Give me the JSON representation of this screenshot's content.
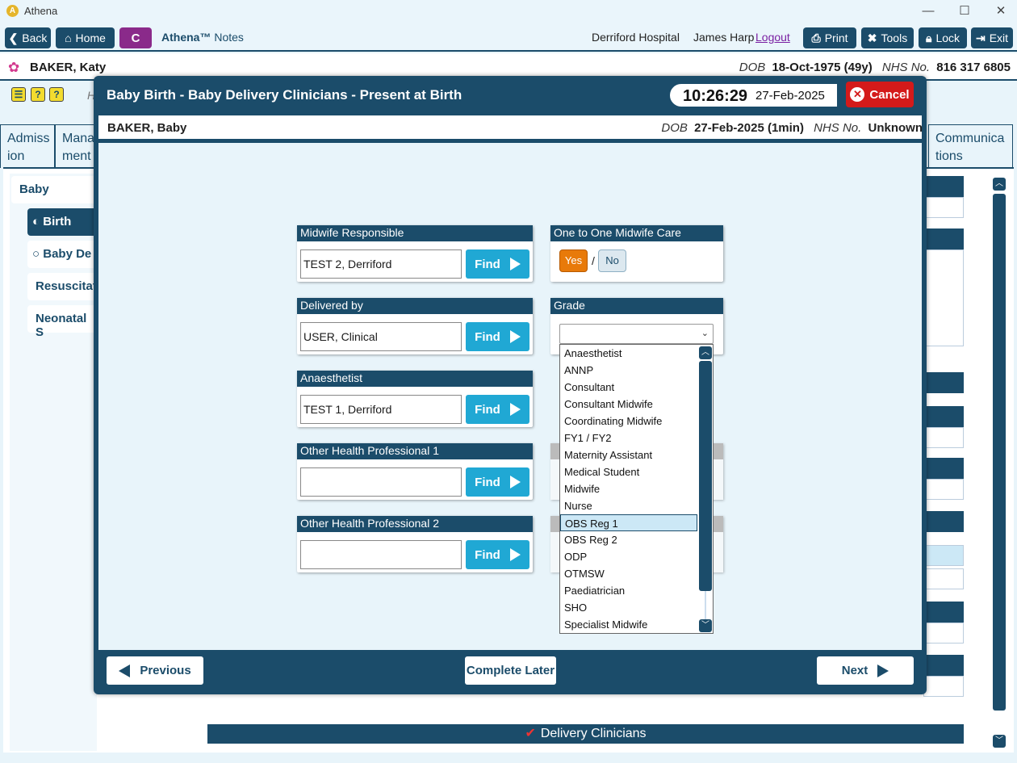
{
  "window": {
    "title": "Athena",
    "minimize": "—",
    "maximize": "☐",
    "close": "✕"
  },
  "toolbar": {
    "back": "Back",
    "home": "Home",
    "c_label": "C",
    "brand": "Athena™",
    "brand_suffix": "Notes",
    "hospital": "Derriford Hospital",
    "user": "James Harp",
    "logout": "Logout",
    "print": "Print",
    "tools": "Tools",
    "lock": "Lock",
    "exit": "Exit"
  },
  "patient": {
    "name": "BAKER, Katy",
    "dob_label": "DOB",
    "dob": "18-Oct-1975 (49y)",
    "nhs_label": "NHS No.",
    "nhs": "816 317 6805"
  },
  "background": {
    "tabs": [
      {
        "label": "Admiss ion"
      },
      {
        "label": "Mana ment"
      },
      {
        "label": "Communica tions"
      }
    ],
    "nav": {
      "section": "Baby",
      "birth": "Birth",
      "baby_dev": "Baby De",
      "resus": "Resuscitati",
      "neonatal": "Neonatal S"
    },
    "bottom_header": "Delivery Clinicians",
    "peek_h": "H"
  },
  "modal": {
    "title": "Baby Birth - Baby Delivery Clinicians - Present at Birth",
    "time": "10:26:29",
    "date": "27-Feb-2025",
    "cancel": "Cancel",
    "baby": {
      "name": "BAKER, Baby",
      "dob_label": "DOB",
      "dob": "27-Feb-2025 (1min)",
      "nhs_label": "NHS No.",
      "nhs": "Unknown"
    },
    "find_label": "Find",
    "cards": [
      {
        "title": "Midwife Responsible",
        "value": "TEST 2, Derriford"
      },
      {
        "title": "Delivered by",
        "value": "USER, Clinical"
      },
      {
        "title": "Anaesthetist",
        "value": "TEST 1, Derriford"
      },
      {
        "title": "Other Health Professional 1",
        "value": ""
      },
      {
        "title": "Other Health Professional 2",
        "value": ""
      }
    ],
    "one_to_one": {
      "title": "One to One Midwife Care Provided",
      "yes": "Yes",
      "slash": "/",
      "no": "No"
    },
    "grade": {
      "title": "Grade",
      "selected_value": "",
      "options": [
        "Anaesthetist",
        "ANNP",
        "Consultant",
        "Consultant Midwife",
        "Coordinating Midwife",
        "FY1 / FY2",
        "Maternity Assistant",
        "Medical Student",
        "Midwife",
        "Nurse",
        "OBS Reg 1",
        "OBS Reg 2",
        "ODP",
        "OTMSW",
        "Paediatrician",
        "SHO",
        "Specialist Midwife"
      ],
      "highlighted": "OBS Reg 1"
    },
    "footer": {
      "previous": "Previous",
      "complete_later": "Complete Later",
      "next": "Next"
    }
  },
  "colors": {
    "primary": "#1b4c6a",
    "accent": "#20a8d4",
    "cancel": "#d41a1a",
    "yes": "#e87a0a",
    "c_badge": "#8a2a8a"
  }
}
